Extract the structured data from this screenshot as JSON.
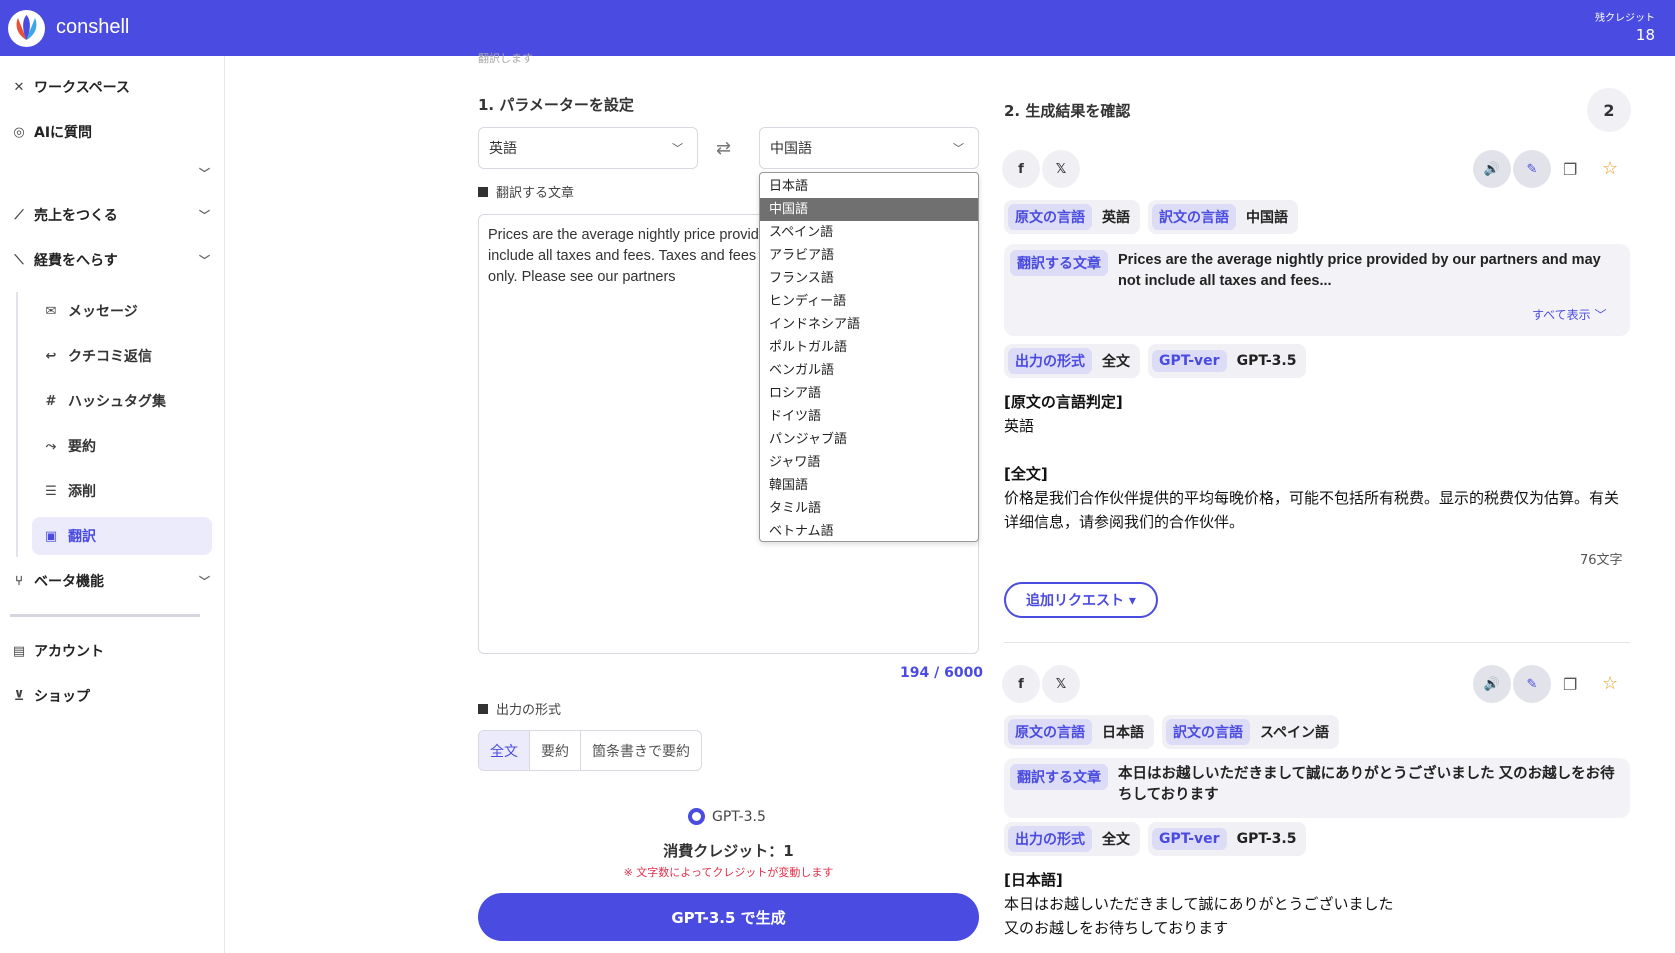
{
  "header": {
    "brand": "conshell",
    "credit_label": "残クレジット",
    "credit_value": "18"
  },
  "sidebar": {
    "workspace": "ワークスペース",
    "ask_ai": "AIに質問",
    "sales": "売上をつくる",
    "cost": "経費をへらす",
    "sub_items": [
      "メッセージ",
      "クチコミ返信",
      "ハッシュタグ集",
      "要約",
      "添削",
      "翻訳"
    ],
    "beta": "ベータ機能",
    "account": "アカウント",
    "shop": "ショップ"
  },
  "form": {
    "cut_text": "翻訳します",
    "title": "1. パラメーターを設定",
    "source_lang": "英語",
    "target_lang": "中国語",
    "text_label": "翻訳する文章",
    "text_value": "Prices are the average nightly price provided by our partners and may not include all taxes and fees. Taxes and fees that are shown are estimates only. Please see our partners",
    "count": "194 / 6000",
    "format_label": "出力の形式",
    "formats": [
      "全文",
      "要約",
      "箇条書きで要約"
    ],
    "selected_format": "全文",
    "model": "GPT-3.5",
    "consume": "消費クレジット：1",
    "note": "※ 文字数によってクレジットが変動します",
    "generate": "GPT-3.5 で生成"
  },
  "dropdown": {
    "options": [
      "日本語",
      "中国語",
      "スペイン語",
      "アラビア語",
      "フランス語",
      "ヒンディー語",
      "インドネシア語",
      "ポルトガル語",
      "ベンガル語",
      "ロシア語",
      "ドイツ語",
      "パンジャブ語",
      "ジャワ語",
      "韓国語",
      "タミル語",
      "ベトナム語"
    ],
    "selected": "中国語"
  },
  "results": {
    "title": "2. 生成結果を確認",
    "count": "2",
    "tags": {
      "src_lang": "原文の言語",
      "dst_lang": "訳文の言語",
      "src_text": "翻訳する文章",
      "format": "出力の形式",
      "gpt": "GPT-ver"
    },
    "show_all": "すべて表示",
    "add_request": "追加リクエスト ▾",
    "items": [
      {
        "src_lang": "英語",
        "dst_lang": "中国語",
        "src_text": "Prices are the average nightly price provided by our partners and may not include all taxes and fees...",
        "format": "全文",
        "gpt": "GPT-3.5",
        "out_h1": "[原文の言語判定]",
        "out_v1": "英語",
        "out_h2": "[全文]",
        "out_v2": "价格是我们合作伙伴提供的平均每晚价格，可能不包括所有税费。显示的税费仅为估算。有关详细信息，请参阅我们的合作伙伴。",
        "char_count": "76文字"
      },
      {
        "src_lang": "日本語",
        "dst_lang": "スペイン語",
        "src_text": "本日はお越しいただきまして誠にありがとうございました 又のお越しをお待ちしております",
        "format": "全文",
        "gpt": "GPT-3.5",
        "out_h1": "[日本語]",
        "out_v1": "本日はお越しいただきまして誠にありがとうございました",
        "out_v2": "又のお越しをお待ちしております"
      }
    ]
  },
  "colors": {
    "accent": "#4a4be0",
    "active_bg": "#ebebfb",
    "star": "#e5a028"
  }
}
